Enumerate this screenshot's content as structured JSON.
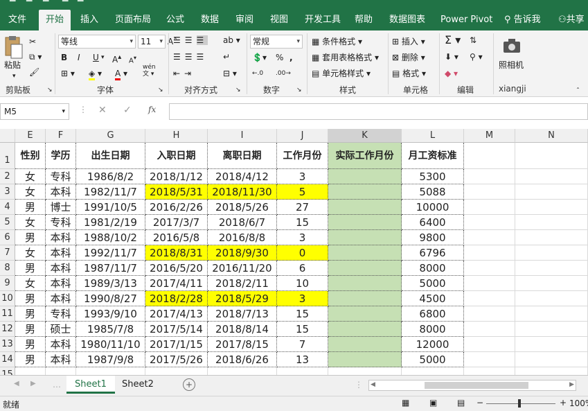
{
  "tabs": [
    "文件",
    "开始",
    "插入",
    "页面布局",
    "公式",
    "数据",
    "审阅",
    "视图",
    "开发工具",
    "帮助",
    "数据图表",
    "Power Pivot"
  ],
  "active_tab": "开始",
  "tell_me": "告诉我",
  "share": "共享",
  "ribbon": {
    "clipboard": {
      "label": "剪贴板",
      "paste": "粘贴"
    },
    "font": {
      "label": "字体",
      "font_name": "等线",
      "font_size": "11",
      "bold": "B",
      "italic": "I",
      "underline": "U",
      "grow": "A",
      "shrink": "A",
      "wen": "wén"
    },
    "alignment": {
      "label": "对齐方式"
    },
    "number": {
      "label": "数字",
      "format": "常规",
      "percent": "%",
      "comma": ","
    },
    "styles": {
      "label": "样式",
      "conditional": "条件格式",
      "table": "套用表格格式",
      "cell": "单元格样式"
    },
    "cells": {
      "label": "单元格",
      "insert": "插入",
      "delete": "删除",
      "format": "格式"
    },
    "editing": {
      "label": "编辑"
    },
    "camera": {
      "label": "xiangji",
      "button": "照相机"
    }
  },
  "name_box": "M5",
  "fx": "fx",
  "columns": [
    "E",
    "F",
    "G",
    "H",
    "I",
    "J",
    "K",
    "L",
    "M",
    "N"
  ],
  "rows": [
    {
      "n": "1",
      "cells": [
        "性别",
        "学历",
        "出生日期",
        "入职日期",
        "离职日期",
        "工作月份",
        "实际工作月份",
        "月工资标准"
      ]
    },
    {
      "n": "2",
      "cells": [
        "女",
        "专科",
        "1986/8/2",
        "2018/1/12",
        "2018/4/12",
        "3",
        "",
        "5300"
      ]
    },
    {
      "n": "3",
      "cells": [
        "女",
        "本科",
        "1982/11/7",
        "2018/5/31",
        "2018/11/30",
        "5",
        "",
        "5088"
      ]
    },
    {
      "n": "4",
      "cells": [
        "男",
        "博士",
        "1991/10/5",
        "2016/2/26",
        "2018/5/26",
        "27",
        "",
        "10000"
      ]
    },
    {
      "n": "5",
      "cells": [
        "女",
        "专科",
        "1981/2/19",
        "2017/3/7",
        "2018/6/7",
        "15",
        "",
        "6400"
      ]
    },
    {
      "n": "6",
      "cells": [
        "男",
        "本科",
        "1988/10/2",
        "2016/5/8",
        "2016/8/8",
        "3",
        "",
        "9800"
      ]
    },
    {
      "n": "7",
      "cells": [
        "女",
        "本科",
        "1992/11/7",
        "2018/8/31",
        "2018/9/30",
        "0",
        "",
        "6796"
      ]
    },
    {
      "n": "8",
      "cells": [
        "男",
        "本科",
        "1987/11/7",
        "2016/5/20",
        "2016/11/20",
        "6",
        "",
        "8000"
      ]
    },
    {
      "n": "9",
      "cells": [
        "女",
        "本科",
        "1989/3/13",
        "2017/4/11",
        "2018/2/11",
        "10",
        "",
        "5000"
      ]
    },
    {
      "n": "10",
      "cells": [
        "男",
        "本科",
        "1990/8/27",
        "2018/2/28",
        "2018/5/29",
        "3",
        "",
        "4500"
      ]
    },
    {
      "n": "11",
      "cells": [
        "男",
        "专科",
        "1993/9/10",
        "2017/4/13",
        "2018/7/13",
        "15",
        "",
        "6800"
      ]
    },
    {
      "n": "12",
      "cells": [
        "男",
        "硕士",
        "1985/7/8",
        "2017/5/14",
        "2018/8/14",
        "15",
        "",
        "8000"
      ]
    },
    {
      "n": "13",
      "cells": [
        "男",
        "本科",
        "1980/11/10",
        "2017/1/15",
        "2017/8/15",
        "7",
        "",
        "12000"
      ]
    },
    {
      "n": "14",
      "cells": [
        "男",
        "本科",
        "1987/9/8",
        "2017/5/26",
        "2018/6/26",
        "13",
        "",
        "5000"
      ]
    },
    {
      "n": "15",
      "cells": [
        "",
        "",
        "",
        "",
        "",
        "",
        "",
        ""
      ]
    }
  ],
  "highlight_rows": [
    "3",
    "7",
    "10"
  ],
  "highlight_color": "#ffff00",
  "column_k_color": "#c6e0b4",
  "sheets": [
    "Sheet1",
    "Sheet2"
  ],
  "active_sheet": "Sheet1",
  "status": "就绪",
  "zoom": "100%",
  "accent": "#217346"
}
